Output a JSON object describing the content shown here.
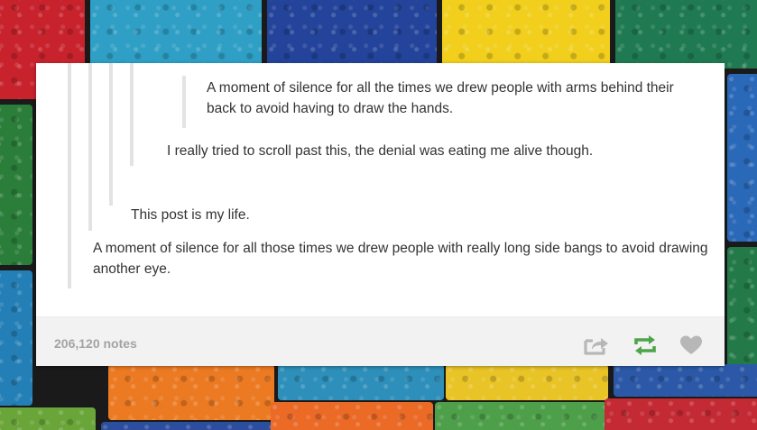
{
  "post": {
    "quote_1": "A moment of silence for all the times we drew people with arms behind their back to avoid having to draw the hands.",
    "quote_2": "I really tried to scroll past this, the denial was eating me alive though.",
    "quote_3": "This post is my life.",
    "quote_4": "A moment of silence for all those times we drew people with really long side bangs to avoid drawing another eye."
  },
  "footer": {
    "notes": "206,120 notes"
  },
  "icons": {
    "share": "share-icon",
    "reblog": "reblog-icon",
    "like": "heart-icon"
  },
  "colors": {
    "reblog": "#4fa44b",
    "icon_gray": "#b7b7b7",
    "notes_text": "#a3a3a3"
  }
}
